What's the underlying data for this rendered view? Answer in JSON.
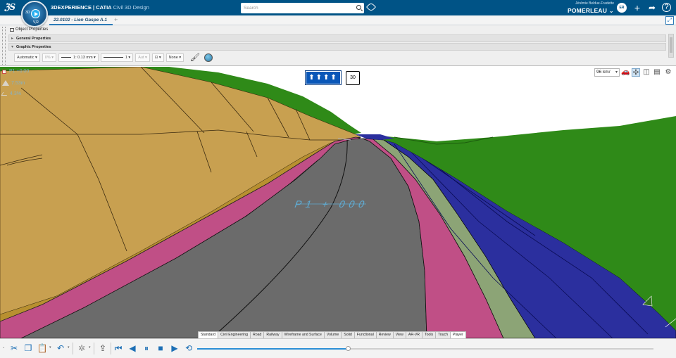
{
  "header": {
    "brand_bold": "3D",
    "brand_rest": "EXPERIENCE | CATIA",
    "app_name": "Civil 3D Design",
    "compass_label_left": "3D",
    "compass_label_bottom": "V,R",
    "search_placeholder": "Search",
    "user_name": "Jérémie Beldue-Fradette",
    "company": "POMERLEAU",
    "avatar_text": "ER"
  },
  "tabs": {
    "document": "22.0102 - Lien Gaspe A.1",
    "add": "+"
  },
  "properties": {
    "title": "Object Properties",
    "sections": [
      {
        "label": "General Properties",
        "expanded": false
      },
      {
        "label": "Graphic Properties",
        "expanded": true
      }
    ],
    "graphic": {
      "color": "Automatic",
      "transparency": "0%",
      "linetype": "1",
      "thickness": "1: 0.13 mm",
      "linetype2": "1",
      "layer": "Aut",
      "symbol": "None"
    }
  },
  "viewport": {
    "lane_sign": "⬆⬆⬆⬆",
    "speed_sign": "30",
    "overlay_station": "P1 +0.00",
    "overlay_elev": "7.53m",
    "overlay_slope": "4.3%",
    "road_label": "P1 + 000",
    "speed_value": "96 km/",
    "colors": {
      "sky": "#ffffff",
      "embankment": "#c8a050",
      "grass": "#2f8a18",
      "road": "#6b6b6b",
      "pink": "#c04f86",
      "sage": "#8ca476",
      "blue": "#2b2f9e"
    }
  },
  "workbench_tabs": [
    "Standard",
    "Civil Engineering",
    "Road",
    "Railway",
    "Wireframe and Surface",
    "Volume",
    "Solid",
    "Functional",
    "Review",
    "View",
    "AR-VR",
    "Tools",
    "Touch",
    "Player"
  ],
  "active_workbench_tab": "Player",
  "player": {
    "progress_fraction": 0.33
  },
  "icons": {
    "top": [
      "ds-logo",
      "compass-icon",
      "search-icon",
      "tag-icon",
      "avatar",
      "add-icon",
      "share-icon",
      "help-icon"
    ],
    "action_bar": [
      "cut-icon",
      "copy-icon",
      "paste-icon",
      "undo-icon",
      "settings-icon",
      "export-icon",
      "skip-start-icon",
      "step-back-icon",
      "pause-icon",
      "stop-icon",
      "step-forward-icon",
      "loop-icon"
    ]
  }
}
